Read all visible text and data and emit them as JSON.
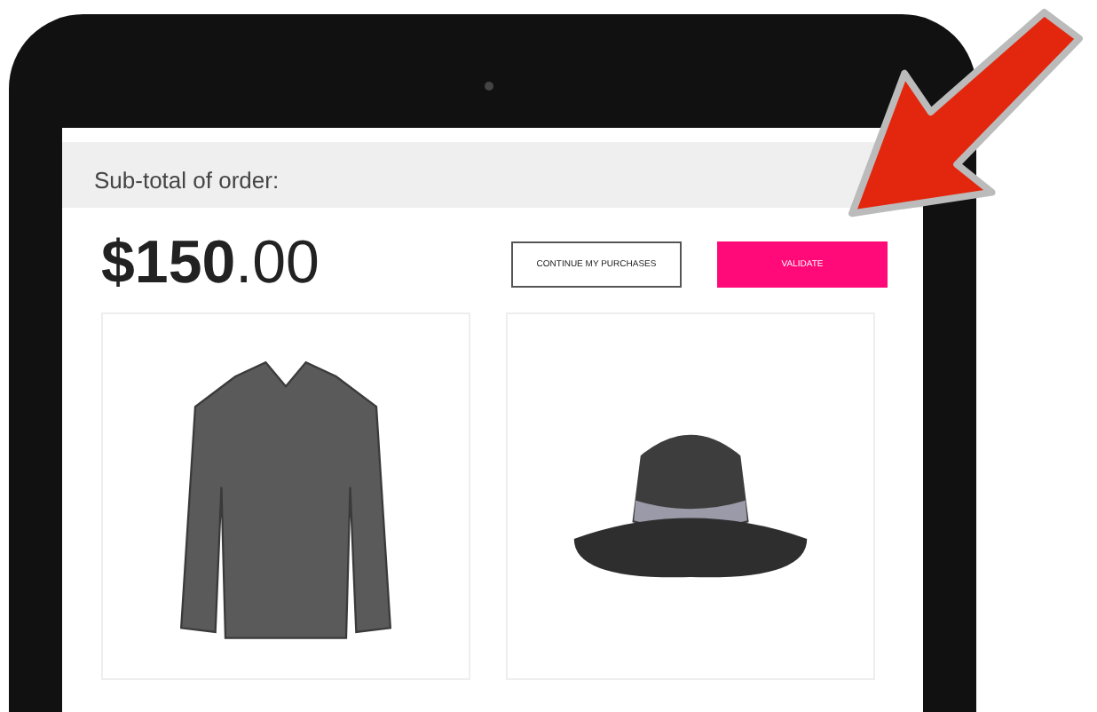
{
  "order": {
    "subtotal_label": "Sub-total of order:",
    "price": "**$150**.00"
  },
  "buttons": [
    {
      "label": "CONTINUE MY PURCHASES",
      "kind": "outline"
    },
    {
      "label": "VALIDATE",
      "kind": "primary"
    }
  ]
}
